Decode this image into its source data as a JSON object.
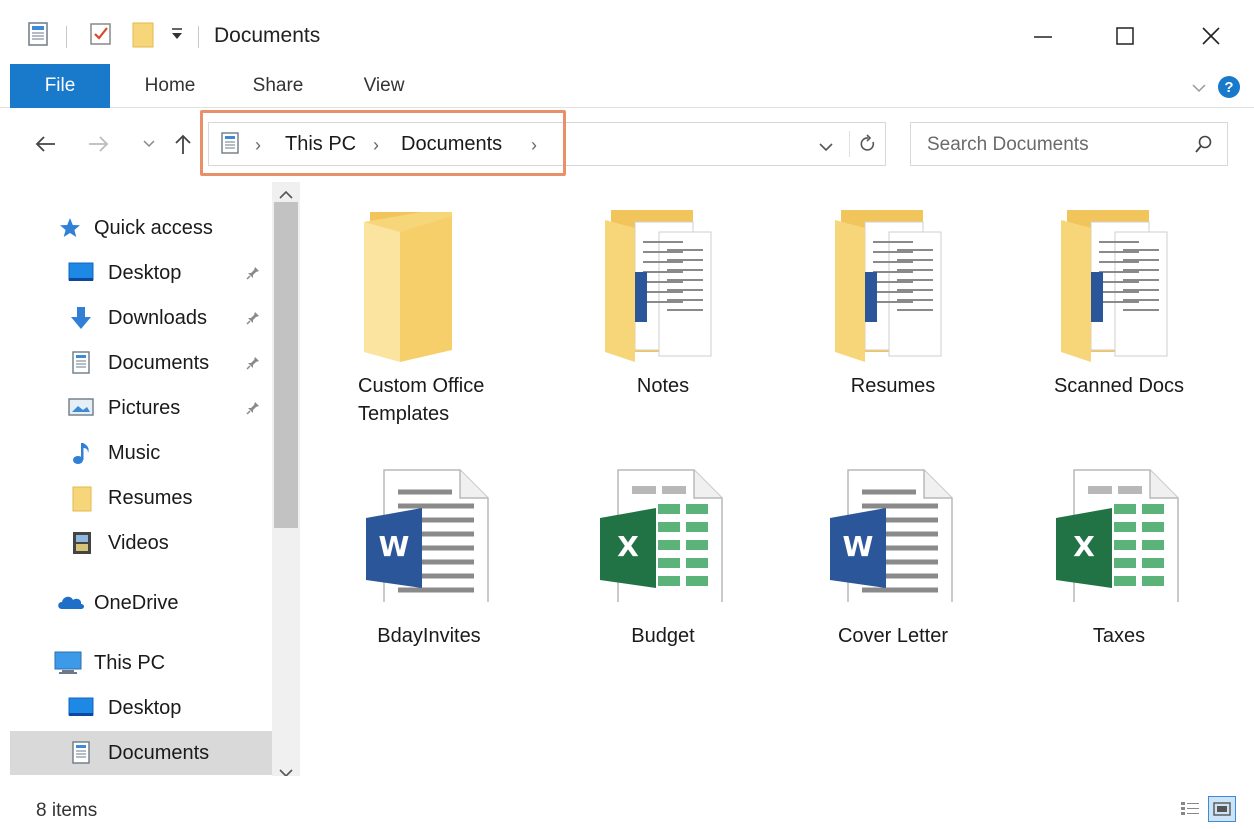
{
  "window": {
    "title": "Documents"
  },
  "ribbon": {
    "tabs": [
      {
        "label": "File"
      },
      {
        "label": "Home"
      },
      {
        "label": "Share"
      },
      {
        "label": "View"
      }
    ],
    "help_label": "?"
  },
  "address": {
    "segments": [
      "This PC",
      "Documents"
    ]
  },
  "search": {
    "placeholder": "Search Documents"
  },
  "sidebar": {
    "quick_access": "Quick access",
    "items": [
      {
        "label": "Desktop",
        "pinned": true,
        "icon": "desktop-icon"
      },
      {
        "label": "Downloads",
        "pinned": true,
        "icon": "downloads-icon"
      },
      {
        "label": "Documents",
        "pinned": true,
        "icon": "documents-icon"
      },
      {
        "label": "Pictures",
        "pinned": true,
        "icon": "pictures-icon"
      },
      {
        "label": "Music",
        "pinned": false,
        "icon": "music-icon"
      },
      {
        "label": "Resumes",
        "pinned": false,
        "icon": "folder-icon"
      },
      {
        "label": "Videos",
        "pinned": false,
        "icon": "videos-icon"
      }
    ],
    "onedrive": "OneDrive",
    "this_pc": "This PC",
    "this_pc_items": [
      {
        "label": "Desktop",
        "icon": "desktop-icon"
      },
      {
        "label": "Documents",
        "icon": "documents-icon",
        "selected": true
      }
    ]
  },
  "files": [
    {
      "name": "Custom Office Templates",
      "line1": "Custom Office",
      "line2": "Templates",
      "type": "folder-empty"
    },
    {
      "name": "Notes",
      "type": "folder-docs"
    },
    {
      "name": "Resumes",
      "type": "folder-docs"
    },
    {
      "name": "Scanned Docs",
      "type": "folder-docs"
    },
    {
      "name": "BdayInvites",
      "type": "word"
    },
    {
      "name": "Budget",
      "type": "excel"
    },
    {
      "name": "Cover Letter",
      "type": "word"
    },
    {
      "name": "Taxes",
      "type": "excel"
    }
  ],
  "status": {
    "item_count": "8 items"
  },
  "colors": {
    "accent": "#1979ca",
    "folder": "#f7d67a",
    "word": "#2b579a",
    "excel": "#217346",
    "highlight": "#e8906a"
  }
}
